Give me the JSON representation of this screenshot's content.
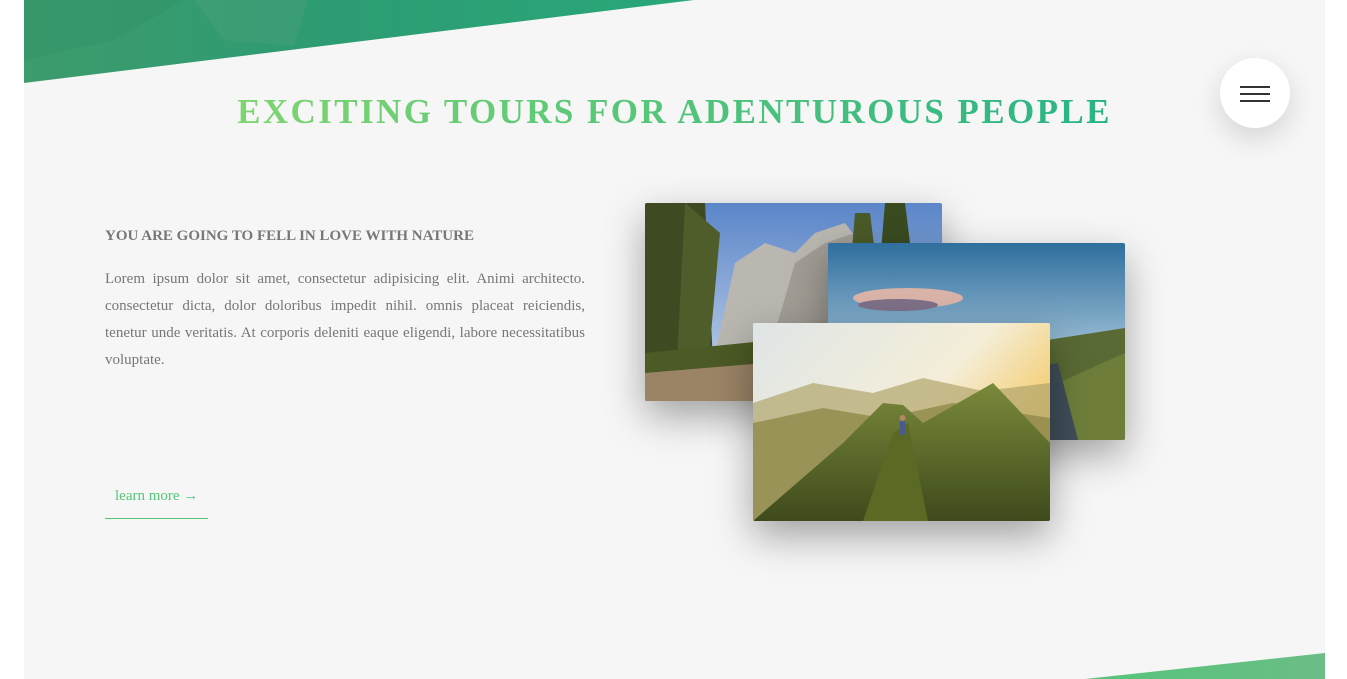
{
  "header": {
    "title": "EXCITING TOURS FOR ADENTUROUS PEOPLE",
    "accent_colors": [
      "#7ed56f",
      "#28b485"
    ]
  },
  "nav": {
    "icon": "hamburger-menu-icon"
  },
  "about": {
    "heading": "YOU ARE GOING TO FELL IN LOVE WITH NATURE",
    "paragraph": "Lorem ipsum dolor sit amet, consectetur adipisicing elit. Animi architecto. consectetur dicta, dolor doloribus impedit nihil. omnis placeat reiciendis, tenetur unde veritatis. At corporis deleniti eaque eligendi, labore necessitatibus voluptate.",
    "link_label": "learn more →"
  },
  "photos": [
    {
      "subject": "forest-mountain-photo"
    },
    {
      "subject": "sunset-lake-photo"
    },
    {
      "subject": "mountain-ridge-hiker-photo"
    }
  ]
}
